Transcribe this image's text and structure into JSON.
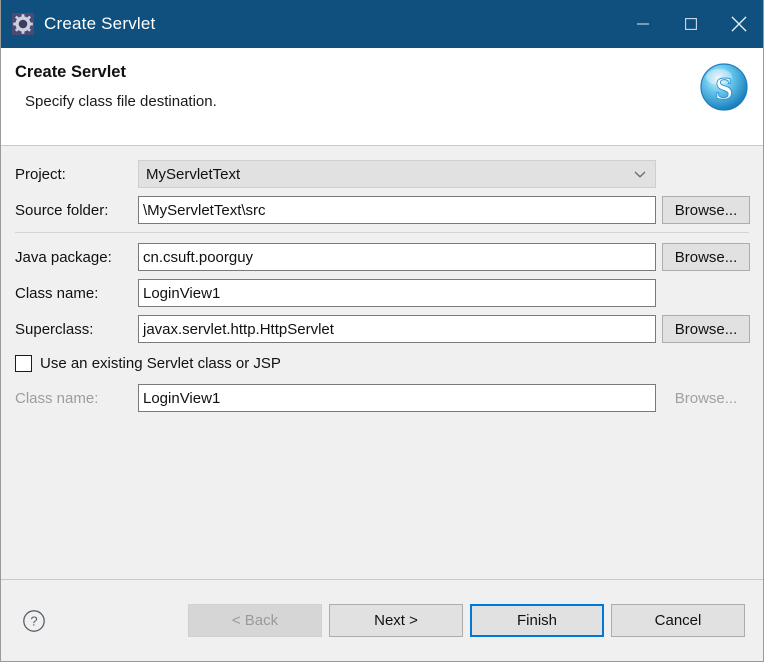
{
  "window": {
    "title": "Create Servlet",
    "icon": "gear-icon",
    "titlebar_color": "#10507f",
    "controls": {
      "minimize": "Minimize",
      "maximize": "Maximize",
      "close": "Close"
    }
  },
  "header": {
    "title": "Create Servlet",
    "description": "Specify class file destination.",
    "logo": "servlet-s-logo"
  },
  "form": {
    "project": {
      "label": "Project:",
      "value": "MyServletText",
      "control": "combobox",
      "chevron": "chevron-down-icon"
    },
    "source_folder": {
      "label": "Source folder:",
      "value": "\\MyServletText\\src",
      "browse_label": "Browse..."
    },
    "java_package": {
      "label": "Java package:",
      "value": "cn.csuft.poorguy",
      "browse_label": "Browse..."
    },
    "class_name": {
      "label": "Class name:",
      "value": "LoginView1"
    },
    "superclass": {
      "label": "Superclass:",
      "value": "javax.servlet.http.HttpServlet",
      "browse_label": "Browse..."
    },
    "use_existing": {
      "label": "Use an existing Servlet class or JSP",
      "checked": false
    },
    "existing_class_name": {
      "label": "Class name:",
      "value": "LoginView1",
      "browse_label": "Browse...",
      "disabled": true
    }
  },
  "footer": {
    "help": "help-icon",
    "buttons": {
      "back": "< Back",
      "next": "Next >",
      "finish": "Finish",
      "cancel": "Cancel"
    },
    "default_button": "Finish",
    "accent_color": "#0078d7"
  }
}
